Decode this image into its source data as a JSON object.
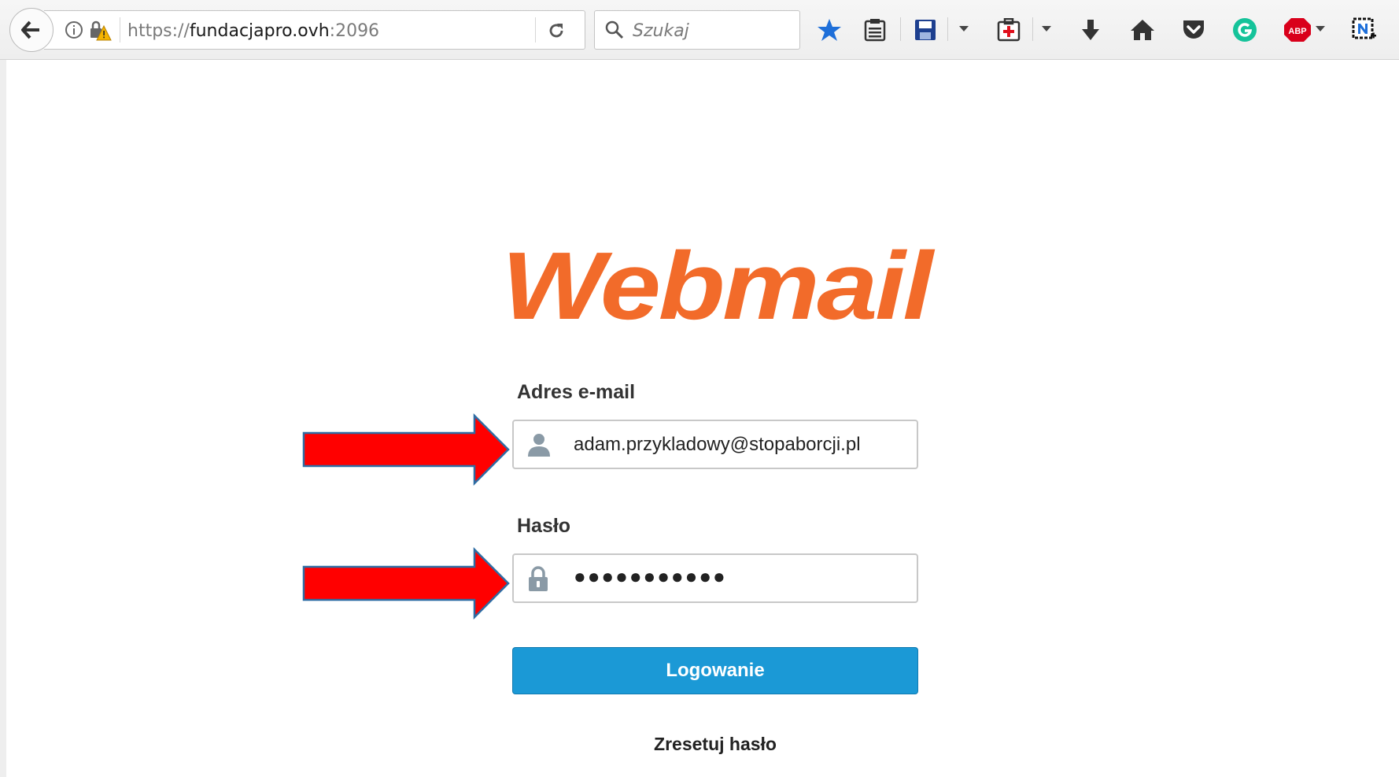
{
  "browser": {
    "url_prefix": "https://",
    "url_host": "fundacjapro.ovh",
    "url_port": ":2096",
    "search_placeholder": "Szukaj",
    "adblock_label": "ABP"
  },
  "page": {
    "logo_text": "Webmail",
    "email_label": "Adres e-mail",
    "email_value": "adam.przykladowy@stopaborcji.pl",
    "password_label": "Hasło",
    "password_value": "●●●●●●●●●●●",
    "login_button": "Logowanie",
    "reset_link": "Zresetuj hasło"
  },
  "colors": {
    "logo": "#f26b2a",
    "button": "#1b99d6",
    "annotation_arrow": "#ff0000"
  }
}
